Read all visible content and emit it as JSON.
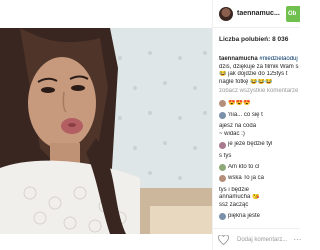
{
  "post": {
    "username": "taennamuc...",
    "follow_label": "Ob",
    "likes": "Liczba polubień: 8 036"
  },
  "caption": {
    "lines": [
      {
        "user": "taennamucha",
        "text": " #niedzielaoduj"
      },
      {
        "text": "dziś, dziękuje za filmik Wam s"
      },
      {
        "text": "😂 jak dojdzie do 125tys t"
      },
      {
        "text": "nagle fotkę 😂😂😂"
      }
    ]
  },
  "view_all": "zobacz wszystkie komentarze",
  "comments": [
    {
      "user": "",
      "text": "😍😍😍"
    },
    {
      "user": "",
      "text": "'nia... co się t"
    },
    {
      "user": "",
      "text": "ajesz na coda"
    },
    {
      "user": "",
      "text": "~ widać :)"
    },
    {
      "user": "",
      "text": "je jeże będzie tyl"
    },
    {
      "user": "",
      "text": "s tys"
    },
    {
      "user": "",
      "text": "Am kto to cl"
    },
    {
      "user": "",
      "text": "wska To ja ca"
    },
    {
      "user": "",
      "text": "tys i będzie"
    },
    {
      "user": "",
      "text": "annamucha 😘"
    },
    {
      "user": "",
      "text": "ssz zacząć"
    },
    {
      "user": "",
      "text": "piękna jeste"
    }
  ],
  "footer": {
    "comment_placeholder": "Dodaj komentarz..."
  }
}
